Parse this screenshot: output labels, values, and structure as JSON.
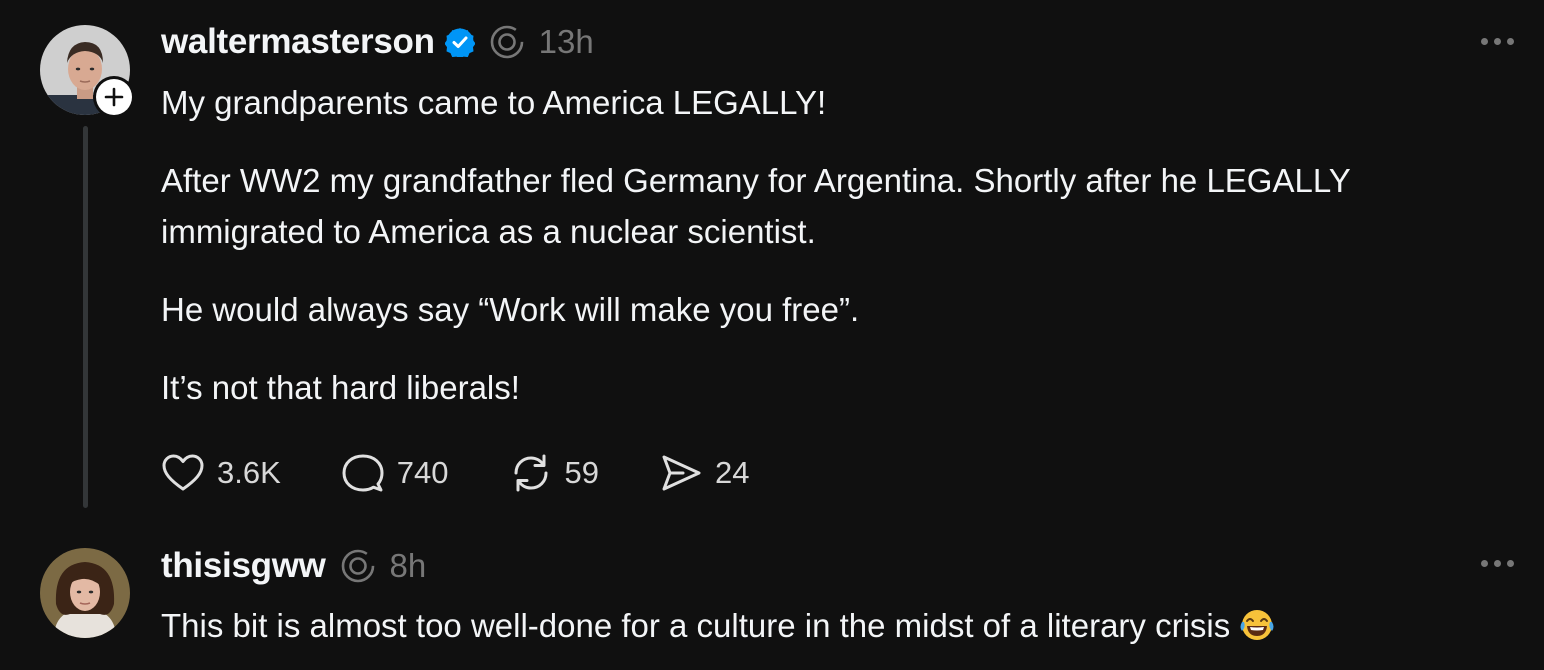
{
  "posts": [
    {
      "username": "waltermasterson",
      "verified": true,
      "timestamp": "13h",
      "paragraphs": [
        "My grandparents came to America LEGALLY!",
        "After WW2 my grandfather fled Germany for Argentina. Shortly after he LEGALLY immigrated to America as a nuclear scientist.",
        "He would always say “Work will make you free”.",
        "It’s not that hard liberals!"
      ],
      "actions": {
        "likes": "3.6K",
        "replies": "740",
        "reposts": "59",
        "shares": "24"
      }
    },
    {
      "username": "thisisgww",
      "verified": false,
      "timestamp": "8h",
      "paragraphs": [
        "This bit is almost too well-done for a culture in the midst of a literary crisis"
      ],
      "emoji": "laughing-crying-emoji"
    }
  ],
  "icons": {
    "verified": "verified-badge-icon",
    "thread": "threads-spiral-icon",
    "more": "more-horizontal-icon",
    "like": "heart-icon",
    "reply": "comment-bubble-icon",
    "repost": "repost-arrows-icon",
    "share": "send-paper-plane-icon",
    "follow": "plus-icon"
  },
  "colors": {
    "background": "#101010",
    "text_primary": "#f3f5f7",
    "text_secondary": "#777777",
    "verified_blue": "#0095f6",
    "thread_line": "#333638"
  }
}
